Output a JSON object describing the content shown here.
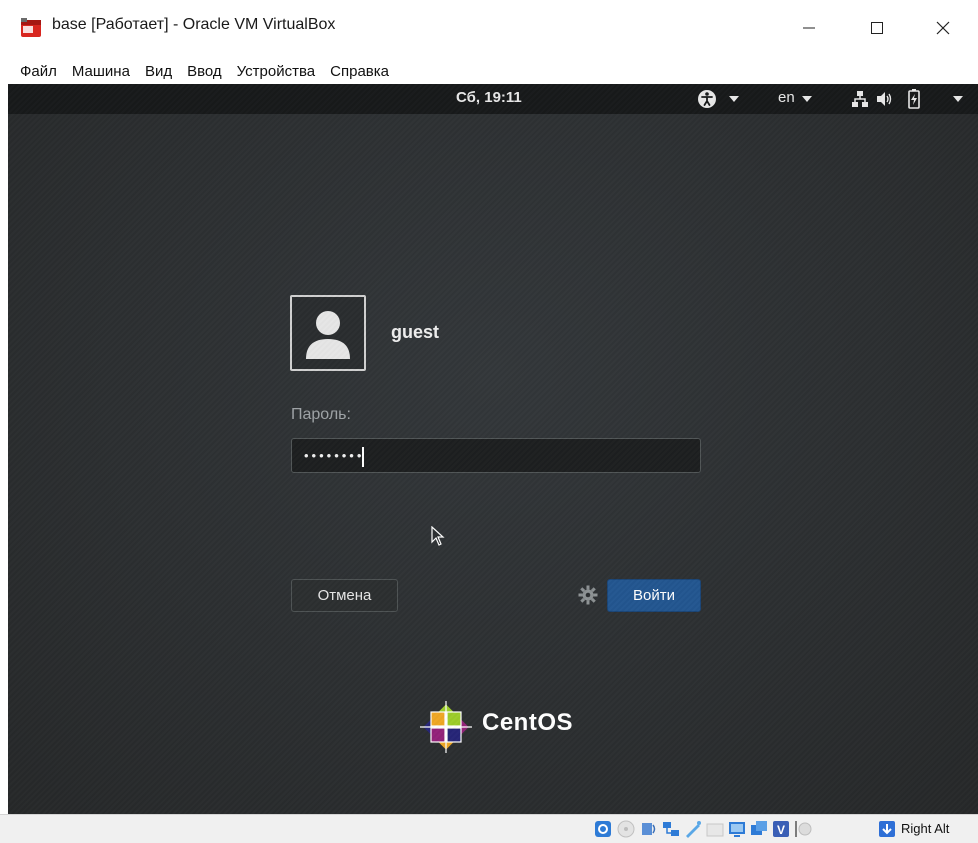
{
  "window": {
    "title": "base [Работает] - Oracle VM VirtualBox",
    "minimize_icon": "minimize-icon",
    "maximize_icon": "maximize-icon",
    "close_icon": "close-icon"
  },
  "menu": {
    "items": [
      "Файл",
      "Машина",
      "Вид",
      "Ввод",
      "Устройства",
      "Справка"
    ]
  },
  "gnome_topbar": {
    "clock": "Сб, 19:11",
    "language": "en",
    "icons": [
      "accessibility-icon",
      "network-icon",
      "volume-icon",
      "battery-icon",
      "chevron-down-icon"
    ]
  },
  "login": {
    "username": "guest",
    "password_label": "Пароль:",
    "password_value": "••••••••",
    "cancel_label": "Отмена",
    "login_label": "Войти"
  },
  "branding": {
    "logo_text": "CentOS"
  },
  "statusbar": {
    "host_key": "Right Alt",
    "icons": [
      "hard-disk-icon",
      "optical-drive-icon",
      "audio-icon",
      "network-adapter-icon",
      "usb-icon",
      "shared-folders-icon",
      "display-icon",
      "recording-icon",
      "virtualization-icon",
      "mouse-integration-icon",
      "keyboard-arrow-icon"
    ]
  },
  "colors": {
    "login_button": "#235690",
    "desktop_bg": "#2c2f31",
    "topbar_bg": "#17191a"
  }
}
